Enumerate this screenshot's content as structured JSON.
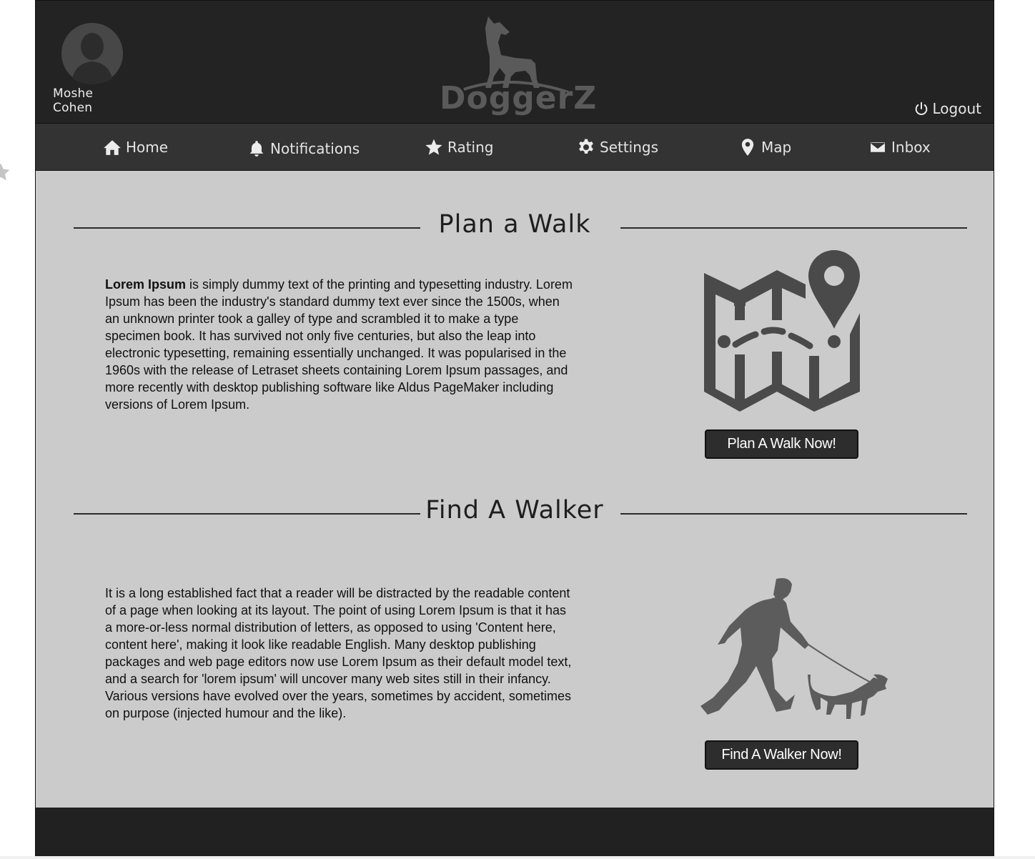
{
  "header": {
    "user_name": "Moshe Cohen",
    "logo_text": "DoggerZ",
    "logout_label": "Logout"
  },
  "nav": {
    "items": [
      {
        "label": "Home",
        "icon": "home-icon"
      },
      {
        "label": "Notifications",
        "icon": "bell-icon"
      },
      {
        "label": "Rating",
        "icon": "star-icon"
      },
      {
        "label": "Settings",
        "icon": "gear-icon"
      },
      {
        "label": "Map",
        "icon": "map-pin-icon"
      },
      {
        "label": "Inbox",
        "icon": "envelope-icon"
      }
    ]
  },
  "sections": {
    "plan": {
      "title": "Plan a Walk",
      "lead_bold": "Lorem Ipsum",
      "body": " is simply dummy text of the printing and typesetting industry. Lorem Ipsum has been the industry's standard dummy text ever since the 1500s, when an unknown printer took a galley of type and scrambled it to make a type specimen book. It has survived not only five centuries, but also the leap into electronic typesetting, remaining essentially unchanged. It was popularised in the 1960s with the release of Letraset sheets containing Lorem Ipsum passages, and more recently with desktop publishing software like Aldus PageMaker including versions of Lorem Ipsum.",
      "button_label": "Plan A Walk Now!",
      "illustration": "map-route-icon"
    },
    "walker": {
      "title": "Find A Walker",
      "body": "It is a long established fact that a reader will be distracted by the readable content of a page when looking at its layout. The point of using Lorem Ipsum is that it has a more-or-less normal distribution of letters, as opposed to using 'Content here, content here', making it look like readable English. Many desktop publishing packages and web page editors now use Lorem Ipsum as their default model text, and a search for 'lorem ipsum' will uncover many web sites still in their infancy. Various versions have evolved over the years, sometimes by accident, sometimes on purpose (injected humour and the like).",
      "button_label": "Find A Walker Now!",
      "illustration": "dog-walker-icon"
    }
  },
  "colors": {
    "header_bg": "#232323",
    "nav_bg": "#333333",
    "content_bg": "#cbcbcb",
    "button_bg": "#2d2d2d",
    "icon_gray": "#4a4a4a"
  }
}
